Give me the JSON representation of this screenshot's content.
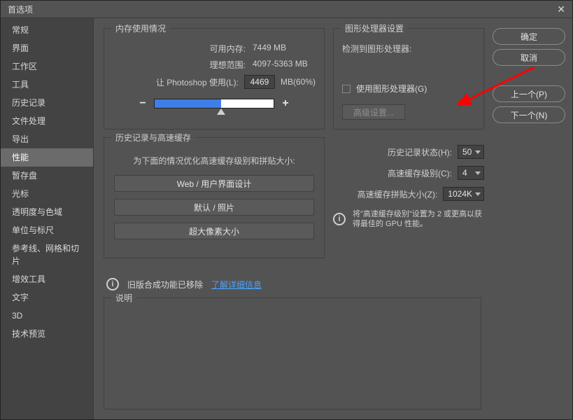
{
  "window_title": "首选项",
  "sidebar": {
    "items": [
      {
        "label": "常规"
      },
      {
        "label": "界面"
      },
      {
        "label": "工作区"
      },
      {
        "label": "工具"
      },
      {
        "label": "历史记录"
      },
      {
        "label": "文件处理"
      },
      {
        "label": "导出"
      },
      {
        "label": "性能",
        "active": true
      },
      {
        "label": "暂存盘"
      },
      {
        "label": "光标"
      },
      {
        "label": "透明度与色域"
      },
      {
        "label": "单位与标尺"
      },
      {
        "label": "参考线、网格和切片"
      },
      {
        "label": "增效工具"
      },
      {
        "label": "文字"
      },
      {
        "label": "3D"
      },
      {
        "label": "技术预览"
      }
    ]
  },
  "actions": {
    "ok": "确定",
    "cancel": "取消",
    "prev": "上一个(P)",
    "next": "下一个(N)"
  },
  "memory": {
    "panel_title": "内存使用情况",
    "avail_label": "可用内存:",
    "avail_value": "7449 MB",
    "ideal_label": "理想范围:",
    "ideal_value": "4097-5363 MB",
    "let_label": "让 Photoshop 使用(L):",
    "let_value": "4469",
    "let_suffix": "MB(60%)"
  },
  "gpu": {
    "panel_title": "图形处理器设置",
    "detect_label": "检测到图形处理器:",
    "use_gpu_label": "使用图形处理器(G)",
    "advanced_btn": "高级设置..."
  },
  "history": {
    "panel_title": "历史记录与高速缓存",
    "desc": "为下面的情况优化高速缓存级别和拼贴大小:",
    "btn1": "Web / 用户界面设计",
    "btn2": "默认 / 照片",
    "btn3": "超大像素大小"
  },
  "right": {
    "states_label": "历史记录状态(H):",
    "states_value": "50",
    "levels_label": "高速缓存级别(C):",
    "levels_value": "4",
    "tile_label": "高速缓存拼贴大小(Z):",
    "tile_value": "1024K",
    "tip": "将\"高速缓存级别\"设置为 2 或更高以获得最佳的 GPU 性能。"
  },
  "legacy": {
    "text": "旧版合成功能已移除",
    "link": "了解详细信息"
  },
  "desc_panel_title": "说明"
}
